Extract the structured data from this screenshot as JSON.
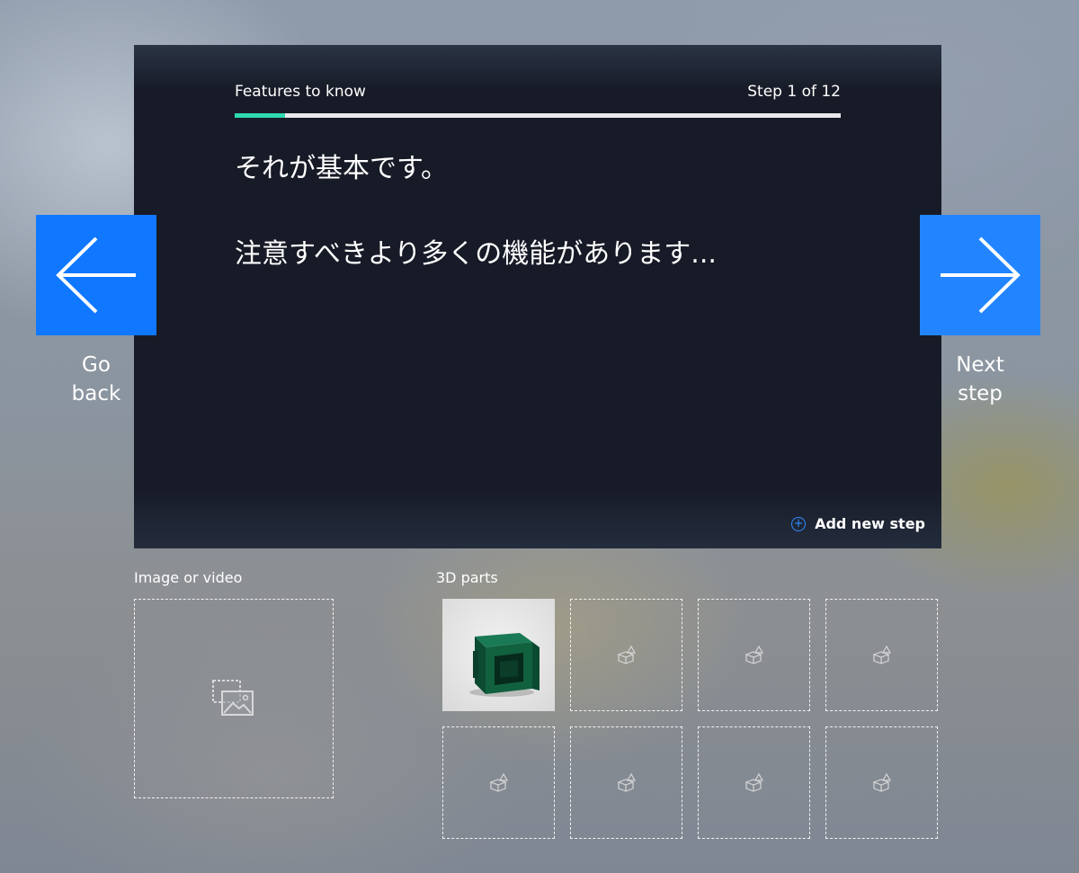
{
  "card": {
    "header_title": "Features to know",
    "step_counter": "Step 1 of 12",
    "progress": {
      "current": 1,
      "total": 12
    },
    "lines": [
      "それが基本です。",
      "注意すべきより多くの機能があります..."
    ],
    "add_step_label": "Add new step"
  },
  "nav": {
    "back": {
      "line1": "Go",
      "line2": "back",
      "icon": "arrow-left-icon"
    },
    "next": {
      "line1": "Next",
      "line2": "step",
      "icon": "arrow-right-icon"
    }
  },
  "media": {
    "label": "Image or video",
    "icon": "image-placeholder-icon"
  },
  "parts": {
    "label": "3D parts",
    "slots": [
      {
        "filled": true,
        "icon": "part-thumbnail"
      },
      {
        "filled": false,
        "icon": "3d-part-icon"
      },
      {
        "filled": false,
        "icon": "3d-part-icon"
      },
      {
        "filled": false,
        "icon": "3d-part-icon"
      },
      {
        "filled": false,
        "icon": "3d-part-icon"
      },
      {
        "filled": false,
        "icon": "3d-part-icon"
      },
      {
        "filled": false,
        "icon": "3d-part-icon"
      },
      {
        "filled": false,
        "icon": "3d-part-icon"
      }
    ]
  },
  "colors": {
    "accent_blue": "#0f78ff",
    "progress": "#2fd9b0",
    "card_bg": "#171b27",
    "part_green": "#0f5a3c"
  }
}
